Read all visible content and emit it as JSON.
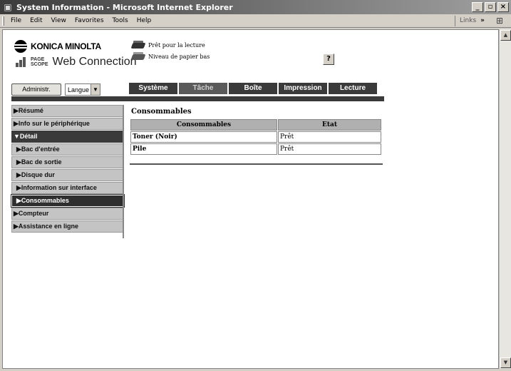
{
  "window": {
    "title": "System Information - Microsoft Internet Explorer",
    "buttons": [
      "_",
      "▫",
      "×"
    ]
  },
  "menubar": {
    "items": [
      "File",
      "Edit",
      "View",
      "Favorites",
      "Tools",
      "Help"
    ],
    "links_label": "Links",
    "links_chevron": "»"
  },
  "header": {
    "brand": "KONICA MINOLTA",
    "pagescope_top": "PAGE",
    "pagescope_bottom": "SCOPE",
    "product": "Web Connection",
    "status_ready": "Prêt pour la lecture",
    "status_paper": "Niveau de papier bas",
    "help_label": "?"
  },
  "controls": {
    "admin_label": "Administr.",
    "language_value": "Langue"
  },
  "tabs": [
    {
      "label": "Système",
      "active": false
    },
    {
      "label": "Tâche",
      "active": true
    },
    {
      "label": "Boîte",
      "active": false
    },
    {
      "label": "Impression",
      "active": false
    },
    {
      "label": "Lecture",
      "active": false
    }
  ],
  "sidebar": {
    "items": [
      {
        "label": "▶Résumé",
        "type": "top"
      },
      {
        "label": "▶Info sur le périphérique",
        "type": "top"
      },
      {
        "label": "▼Détail",
        "type": "open"
      },
      {
        "label": "▶Bac d'entrée",
        "type": "sub"
      },
      {
        "label": "▶Bac de sortie",
        "type": "sub"
      },
      {
        "label": "▶Disque dur",
        "type": "sub"
      },
      {
        "label": "▶Information sur interface",
        "type": "sub"
      },
      {
        "label": "▶Consommables",
        "type": "current"
      },
      {
        "label": "▶Compteur",
        "type": "top"
      },
      {
        "label": "▶Assistance en ligne",
        "type": "top"
      }
    ]
  },
  "content": {
    "title": "Consommables",
    "table": {
      "headers": [
        "Consommables",
        "Etat"
      ],
      "rows": [
        [
          "Toner (Noir)",
          "Prêt"
        ],
        [
          "Pile",
          "Prêt"
        ]
      ]
    }
  },
  "colors": {
    "tab_dark": "#3a3a3a",
    "sidebar_item": "#c4c4c4",
    "table_header": "#b0b0b0"
  }
}
